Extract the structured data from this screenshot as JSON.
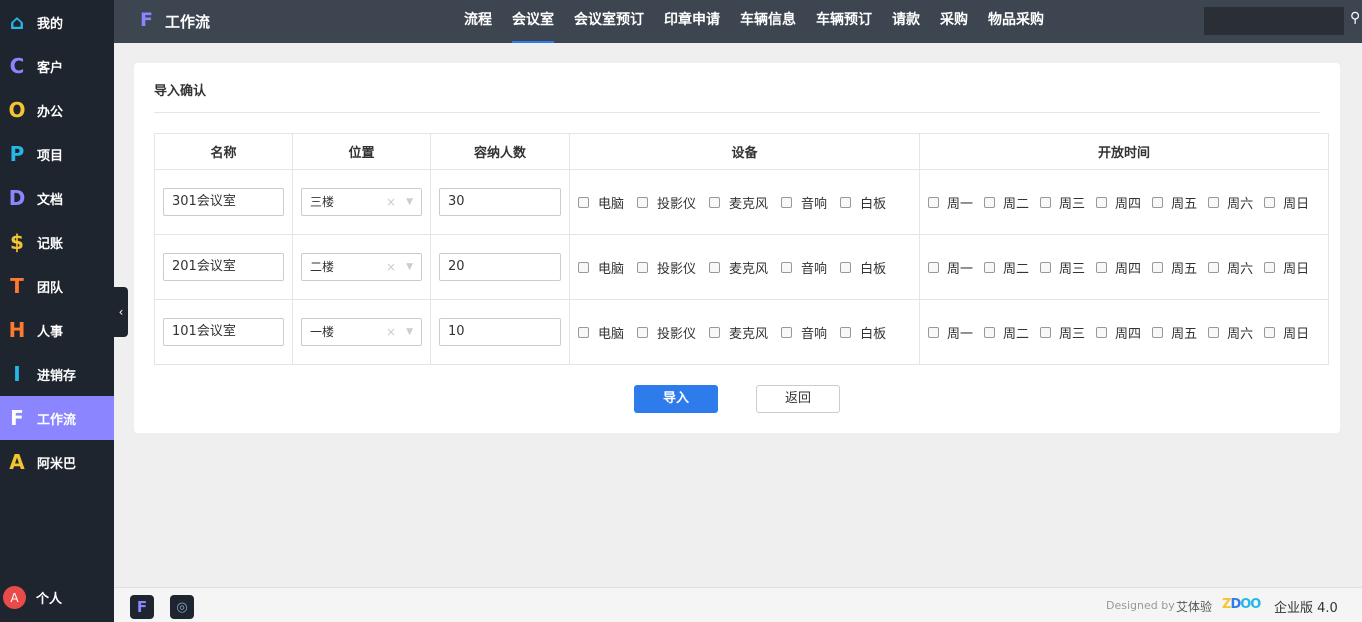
{
  "sidebar": {
    "items": [
      {
        "icon": "⌂",
        "color": "#25b7e8",
        "icon_name": "home-icon",
        "label": "我的"
      },
      {
        "icon": "C",
        "color": "#8b86ff",
        "icon_name": "c-letter-icon",
        "label": "客户"
      },
      {
        "icon": "O",
        "color": "#f5c531",
        "icon_name": "o-letter-icon",
        "label": "办公"
      },
      {
        "icon": "P",
        "color": "#25b7e8",
        "icon_name": "p-letter-icon",
        "label": "项目"
      },
      {
        "icon": "D",
        "color": "#8b86ff",
        "icon_name": "d-letter-icon",
        "label": "文档"
      },
      {
        "icon": "$",
        "color": "#f5c531",
        "icon_name": "dollar-icon",
        "label": "记账"
      },
      {
        "icon": "T",
        "color": "#ff7a2e",
        "icon_name": "t-letter-icon",
        "label": "团队"
      },
      {
        "icon": "H",
        "color": "#ff7a2e",
        "icon_name": "h-letter-icon",
        "label": "人事"
      },
      {
        "icon": "I",
        "color": "#25b7e8",
        "icon_name": "i-letter-icon",
        "label": "进销存"
      },
      {
        "icon": "F",
        "color": "#ffffff",
        "icon_name": "f-letter-icon",
        "label": "工作流",
        "active": true
      },
      {
        "icon": "A",
        "color": "#f5c531",
        "icon_name": "a-letter-icon",
        "label": "阿米巴"
      }
    ],
    "user": {
      "avatar_letter": "A",
      "name": "个人"
    }
  },
  "topbar": {
    "logo_letter": "F",
    "app_title": "工作流",
    "nav": [
      "流程",
      "会议室",
      "会议室预订",
      "印章申请",
      "车辆信息",
      "车辆预订",
      "请款",
      "采购",
      "物品采购"
    ],
    "active_index": 1
  },
  "panel": {
    "title": "导入确认",
    "headers": [
      "名称",
      "位置",
      "容纳人数",
      "设备",
      "开放时间"
    ],
    "equipment_options": [
      "电脑",
      "投影仪",
      "麦克风",
      "音响",
      "白板"
    ],
    "day_options": [
      "周一",
      "周二",
      "周三",
      "周四",
      "周五",
      "周六",
      "周日"
    ],
    "rows": [
      {
        "name": "301会议室",
        "position": "三楼",
        "capacity": "30"
      },
      {
        "name": "201会议室",
        "position": "二楼",
        "capacity": "20"
      },
      {
        "name": "101会议室",
        "position": "一楼",
        "capacity": "10"
      }
    ],
    "import_label": "导入",
    "back_label": "返回"
  },
  "footer": {
    "designed_by": "Designed by",
    "brand": "艾体验",
    "logo_text": "ZDOO",
    "edition": "企业版 4.0"
  }
}
